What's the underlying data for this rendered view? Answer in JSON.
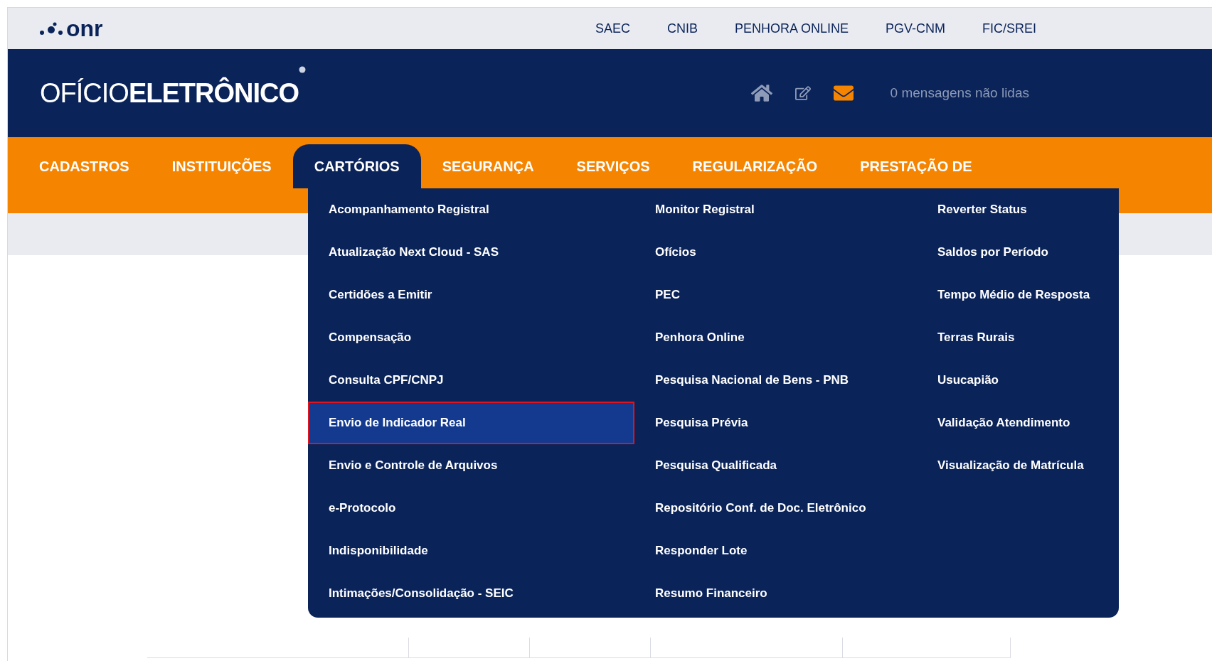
{
  "logo": {
    "text": "onr"
  },
  "top_links": [
    "SAEC",
    "CNIB",
    "PENHORA ONLINE",
    "PGV-CNM",
    "FIC/SREI"
  ],
  "header": {
    "title": "OFÍCIO**ELETRÔNICO**",
    "messages": "0 mensagens não lidas"
  },
  "nav": [
    {
      "label": "CADASTROS",
      "selected": false
    },
    {
      "label": "INSTITUIÇÕES",
      "selected": false
    },
    {
      "label": "CARTÓRIOS",
      "selected": true
    },
    {
      "label": "SEGURANÇA",
      "selected": false
    },
    {
      "label": "SERVIÇOS",
      "selected": false
    },
    {
      "label": "REGULARIZAÇÃO",
      "selected": false
    },
    {
      "label": "PRESTAÇÃO DE",
      "selected": false
    }
  ],
  "dropdown": {
    "columns": [
      [
        {
          "label": "Acompanhamento Registral",
          "selected": false
        },
        {
          "label": "Atualização Next Cloud - SAS",
          "selected": false
        },
        {
          "label": "Certidões a Emitir",
          "selected": false
        },
        {
          "label": "Compensação",
          "selected": false
        },
        {
          "label": "Consulta CPF/CNPJ",
          "selected": false
        },
        {
          "label": "Envio de Indicador Real",
          "selected": true
        },
        {
          "label": "Envio e Controle de Arquivos",
          "selected": false
        },
        {
          "label": "e-Protocolo",
          "selected": false
        },
        {
          "label": "Indisponibilidade",
          "selected": false
        },
        {
          "label": "Intimações/Consolidação - SEIC",
          "selected": false
        }
      ],
      [
        {
          "label": "Monitor Registral",
          "selected": false
        },
        {
          "label": "Ofícios",
          "selected": false
        },
        {
          "label": "PEC",
          "selected": false
        },
        {
          "label": "Penhora Online",
          "selected": false
        },
        {
          "label": "Pesquisa Nacional de Bens - PNB",
          "selected": false
        },
        {
          "label": "Pesquisa Prévia",
          "selected": false
        },
        {
          "label": "Pesquisa Qualificada",
          "selected": false
        },
        {
          "label": "Repositório Conf. de Doc. Eletrônico",
          "selected": false
        },
        {
          "label": "Responder Lote",
          "selected": false
        },
        {
          "label": "Resumo Financeiro",
          "selected": false
        }
      ],
      [
        {
          "label": "Reverter Status",
          "selected": false
        },
        {
          "label": "Saldos por Período",
          "selected": false
        },
        {
          "label": "Tempo Médio de Resposta",
          "selected": false
        },
        {
          "label": "Terras Rurais",
          "selected": false
        },
        {
          "label": "Usucapião",
          "selected": false
        },
        {
          "label": "Validação Atendimento",
          "selected": false
        },
        {
          "label": "Visualização de Matrícula",
          "selected": false
        }
      ]
    ]
  }
}
